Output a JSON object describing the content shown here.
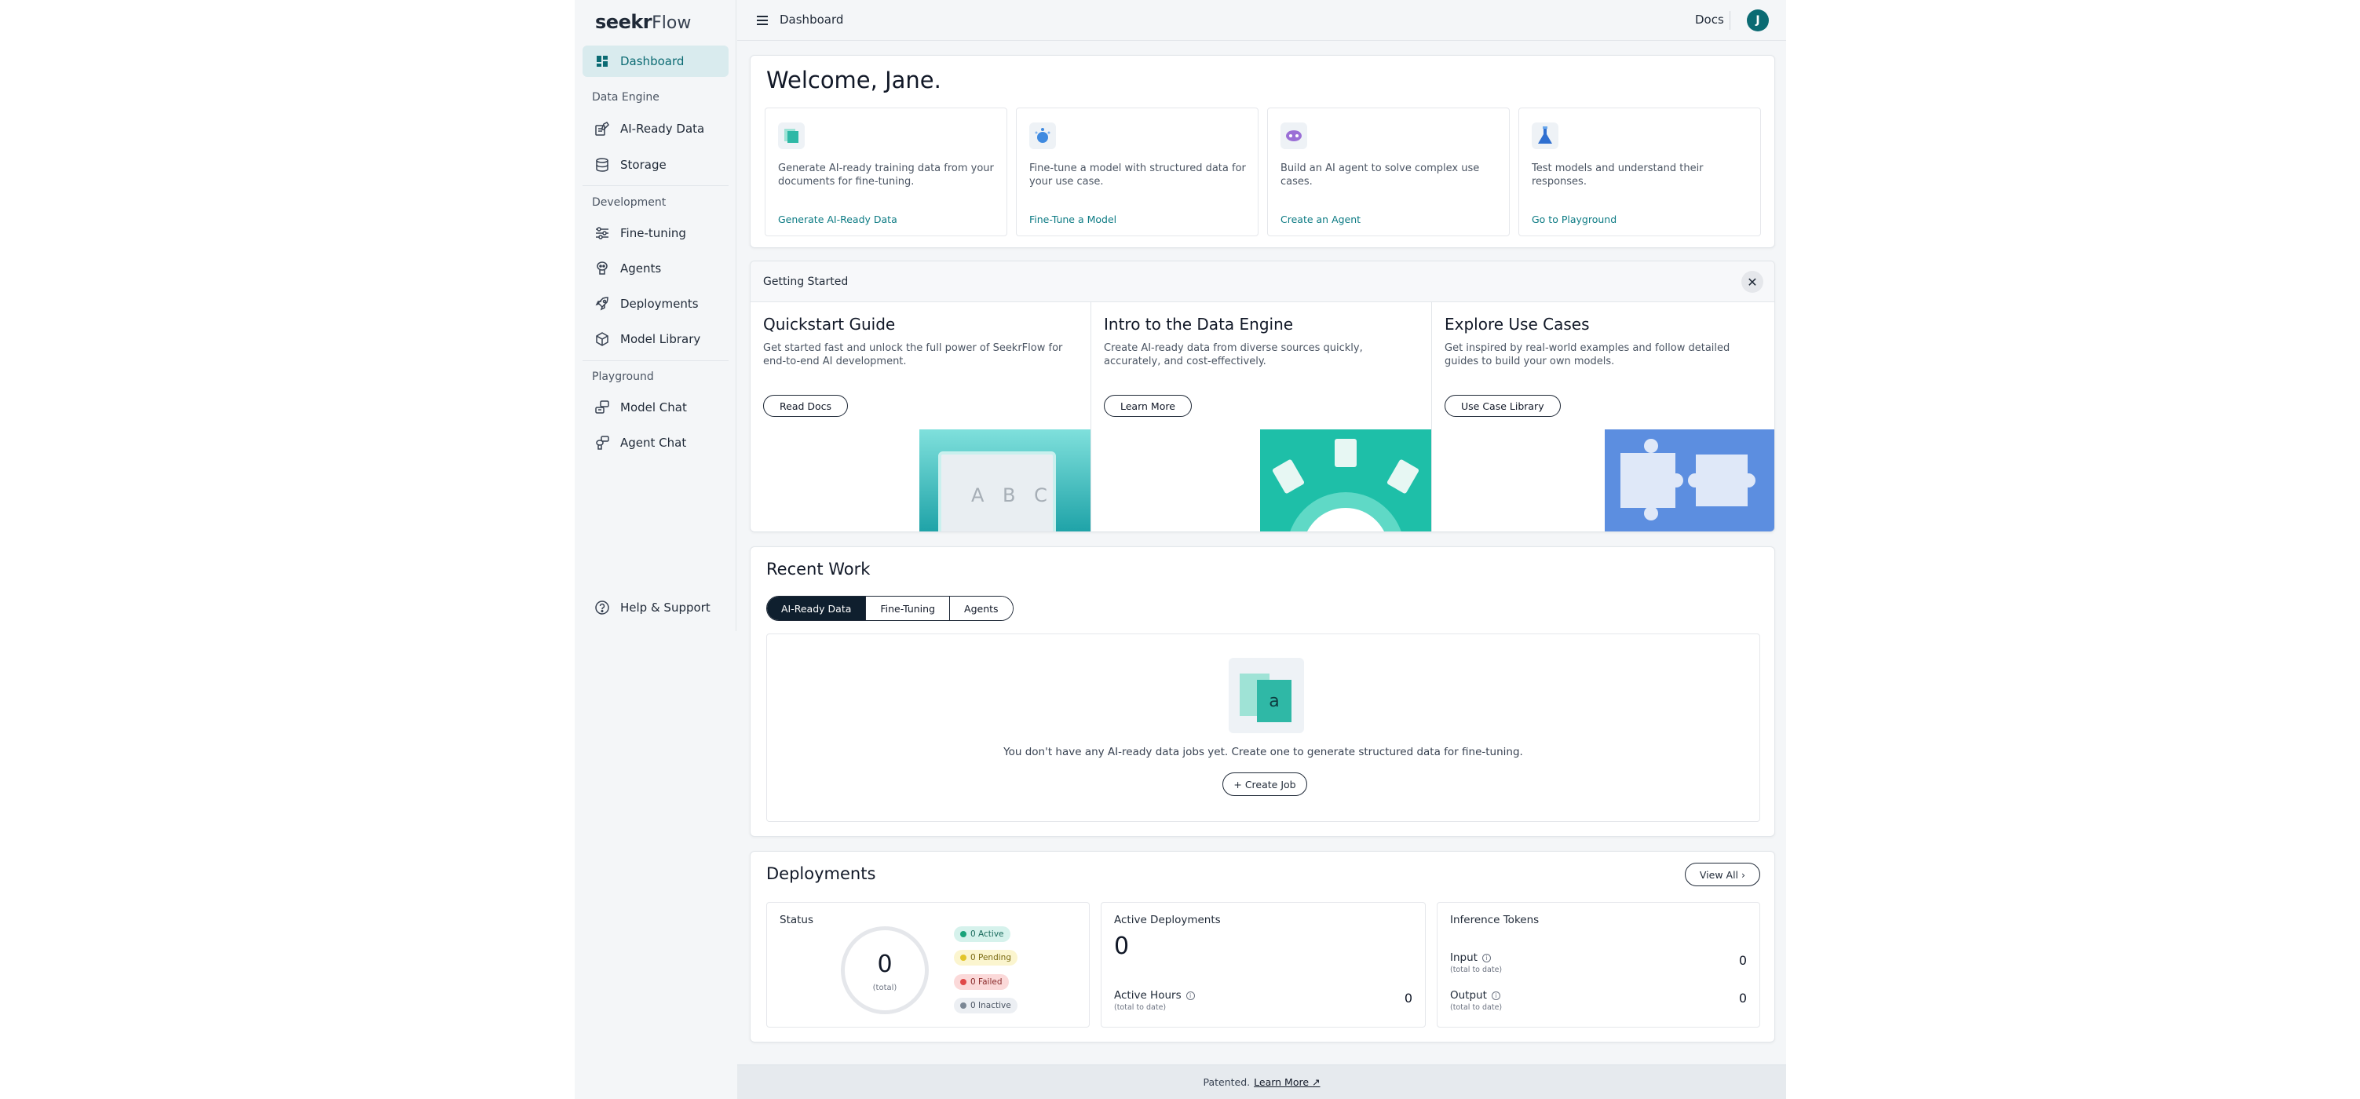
{
  "brand": {
    "seekr": "seekr",
    "flow": "Flow"
  },
  "sidebar": {
    "dashboard": "Dashboard",
    "sections": [
      "Data Engine",
      "Development",
      "Playground"
    ],
    "data_engine": [
      "AI-Ready Data",
      "Storage"
    ],
    "development": [
      "Fine-tuning",
      "Agents",
      "Deployments",
      "Model Library"
    ],
    "playground": [
      "Model Chat",
      "Agent Chat"
    ],
    "help": "Help & Support"
  },
  "topbar": {
    "title": "Dashboard",
    "docs": "Docs",
    "avatar": "J"
  },
  "welcome": {
    "title": "Welcome, Jane.",
    "cards": [
      {
        "desc": "Generate AI-ready training data from your documents for fine-tuning.",
        "link": "Generate AI-Ready Data",
        "icon": "data-stack-icon"
      },
      {
        "desc": "Fine-tune a model with structured data for your use case.",
        "link": "Fine-Tune a Model",
        "icon": "model-tune-icon"
      },
      {
        "desc": "Build an AI agent to solve complex use cases.",
        "link": "Create an Agent",
        "icon": "agent-icon"
      },
      {
        "desc": "Test models and understand their responses.",
        "link": "Go to Playground",
        "icon": "flask-icon"
      }
    ]
  },
  "getting_started": {
    "title": "Getting Started",
    "columns": [
      {
        "title": "Quickstart Guide",
        "desc": "Get started fast and unlock the full power of SeekrFlow for end-to-end AI development.",
        "button": "Read Docs",
        "illus_text": "A B C"
      },
      {
        "title": "Intro to the Data Engine",
        "desc": "Create AI-ready data from diverse sources quickly, accurately, and cost-effectively.",
        "button": "Learn More"
      },
      {
        "title": "Explore Use Cases",
        "desc": "Get inspired by real-world examples and follow detailed guides to build your own models.",
        "button": "Use Case Library"
      }
    ]
  },
  "recent_work": {
    "title": "Recent Work",
    "tabs": [
      "AI-Ready Data",
      "Fine-Tuning",
      "Agents"
    ],
    "empty_text": "You don't have any AI-ready data jobs yet. Create one to generate structured data for fine-tuning.",
    "create_button": "+ Create Job",
    "empty_icon_letter": "a"
  },
  "deployments": {
    "title": "Deployments",
    "view_all": "View All ›",
    "status": {
      "label": "Status",
      "total": "0",
      "total_label": "(total)",
      "badges": [
        {
          "text": "0 Active",
          "bg": "#d6f2ec",
          "dot": "#1aa37a",
          "color": "#17695a"
        },
        {
          "text": "0 Pending",
          "bg": "#fbf5cf",
          "dot": "#e2c52a",
          "color": "#7a6a12"
        },
        {
          "text": "0 Failed",
          "bg": "#fbd9d9",
          "dot": "#e04848",
          "color": "#8a2a2a"
        },
        {
          "text": "0 Inactive",
          "bg": "#eceff3",
          "dot": "#7b8794",
          "color": "#4b5563"
        }
      ]
    },
    "active": {
      "label": "Active Deployments",
      "value": "0",
      "hours_label": "Active Hours",
      "hours_sub": "(total to date)",
      "hours_value": "0"
    },
    "tokens": {
      "label": "Inference Tokens",
      "input_label": "Input",
      "input_sub": "(total to date)",
      "input_value": "0",
      "output_label": "Output",
      "output_sub": "(total to date)",
      "output_value": "0"
    }
  },
  "footer": {
    "text": "Patented.",
    "link": "Learn More"
  }
}
